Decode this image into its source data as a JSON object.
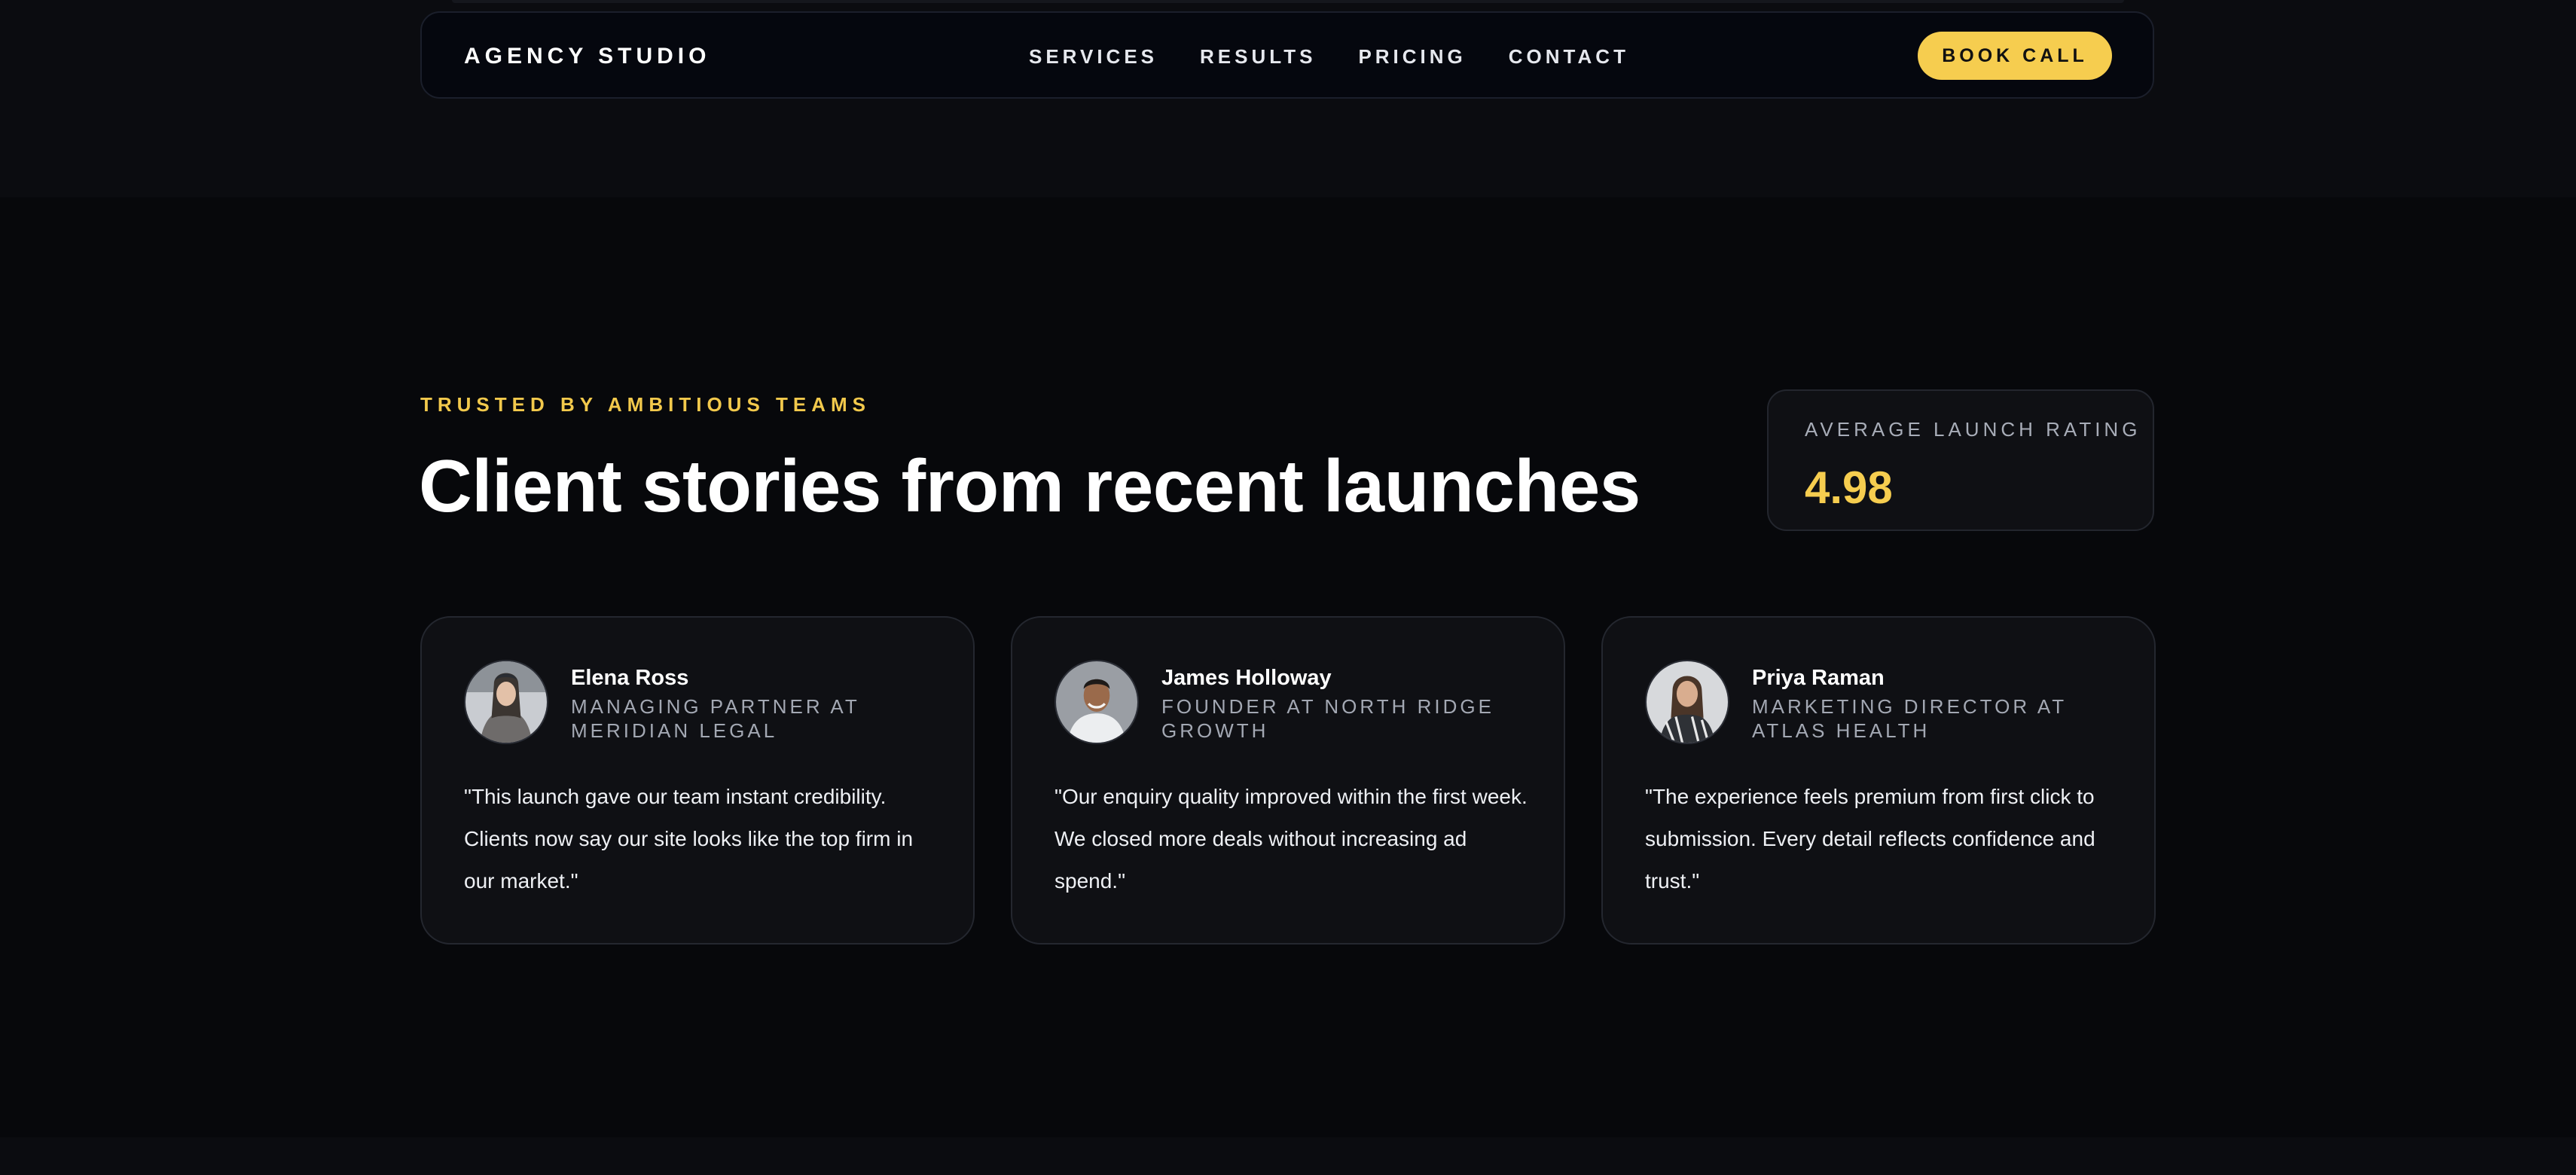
{
  "nav": {
    "brand": "AGENCY STUDIO",
    "links": [
      "SERVICES",
      "RESULTS",
      "PRICING",
      "CONTACT"
    ],
    "cta": "BOOK CALL"
  },
  "hero": {
    "eyebrow": "TRUSTED BY AMBITIOUS TEAMS",
    "title": "Client stories from recent launches"
  },
  "rating": {
    "label": "AVERAGE LAUNCH RATING",
    "value": "4.98"
  },
  "testimonials": [
    {
      "name": "Elena Ross",
      "role": "MANAGING PARTNER AT MERIDIAN LEGAL",
      "quote": "\"This launch gave our team instant credibility. Clients now say our site looks like the top firm in our market.\""
    },
    {
      "name": "James Holloway",
      "role": "FOUNDER AT NORTH RIDGE GROWTH",
      "quote": "\"Our enquiry quality improved within the first week. We closed more deals without increasing ad spend.\""
    },
    {
      "name": "Priya Raman",
      "role": "MARKETING DIRECTOR AT ATLAS HEALTH",
      "quote": "\"The experience feels premium from first click to submission. Every detail reflects confidence and trust.\""
    }
  ],
  "colors": {
    "background": "#07080b",
    "accent": "#f6cd4f",
    "card": "#0f1014"
  }
}
